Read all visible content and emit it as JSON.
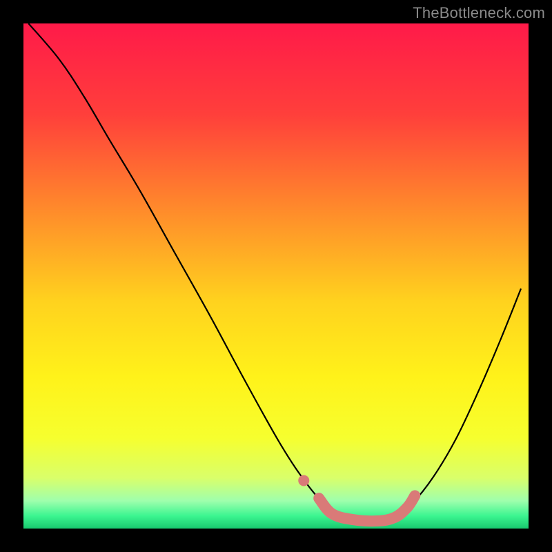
{
  "watermark": "TheBottleneck.com",
  "chart_data": {
    "type": "line",
    "title": "",
    "xlabel": "",
    "ylabel": "",
    "xlim": [
      0,
      1
    ],
    "ylim": [
      0,
      1
    ],
    "gradient_stops": [
      {
        "offset": 0.0,
        "color": "#ff1a49"
      },
      {
        "offset": 0.18,
        "color": "#ff3f3b"
      },
      {
        "offset": 0.38,
        "color": "#ff8f2a"
      },
      {
        "offset": 0.55,
        "color": "#ffd21e"
      },
      {
        "offset": 0.7,
        "color": "#fff21a"
      },
      {
        "offset": 0.82,
        "color": "#f6ff2e"
      },
      {
        "offset": 0.9,
        "color": "#d9ff6a"
      },
      {
        "offset": 0.945,
        "color": "#9fffad"
      },
      {
        "offset": 0.975,
        "color": "#3cf590"
      },
      {
        "offset": 1.0,
        "color": "#18c96f"
      }
    ],
    "series": [
      {
        "name": "bottleneck-curve",
        "stroke": "#000000",
        "stroke_width": 2.2,
        "points": [
          {
            "x": 0.01,
            "y": 1.0
          },
          {
            "x": 0.07,
            "y": 0.93
          },
          {
            "x": 0.12,
            "y": 0.855
          },
          {
            "x": 0.17,
            "y": 0.77
          },
          {
            "x": 0.23,
            "y": 0.67
          },
          {
            "x": 0.3,
            "y": 0.545
          },
          {
            "x": 0.37,
            "y": 0.42
          },
          {
            "x": 0.44,
            "y": 0.29
          },
          {
            "x": 0.51,
            "y": 0.165
          },
          {
            "x": 0.56,
            "y": 0.09
          },
          {
            "x": 0.595,
            "y": 0.05
          },
          {
            "x": 0.63,
            "y": 0.025
          },
          {
            "x": 0.665,
            "y": 0.013
          },
          {
            "x": 0.7,
            "y": 0.012
          },
          {
            "x": 0.735,
            "y": 0.022
          },
          {
            "x": 0.77,
            "y": 0.05
          },
          {
            "x": 0.81,
            "y": 0.1
          },
          {
            "x": 0.855,
            "y": 0.175
          },
          {
            "x": 0.9,
            "y": 0.27
          },
          {
            "x": 0.945,
            "y": 0.375
          },
          {
            "x": 0.985,
            "y": 0.475
          }
        ]
      },
      {
        "name": "highlight-band",
        "stroke": "#d97a78",
        "stroke_width": 16,
        "linecap": "round",
        "points": [
          {
            "x": 0.585,
            "y": 0.06
          },
          {
            "x": 0.61,
            "y": 0.03
          },
          {
            "x": 0.65,
            "y": 0.018
          },
          {
            "x": 0.7,
            "y": 0.015
          },
          {
            "x": 0.735,
            "y": 0.022
          },
          {
            "x": 0.76,
            "y": 0.042
          },
          {
            "x": 0.775,
            "y": 0.065
          }
        ]
      },
      {
        "name": "highlight-dot",
        "type_override": "scatter",
        "fill": "#d97a78",
        "radius": 8,
        "points": [
          {
            "x": 0.555,
            "y": 0.095
          }
        ]
      }
    ]
  }
}
